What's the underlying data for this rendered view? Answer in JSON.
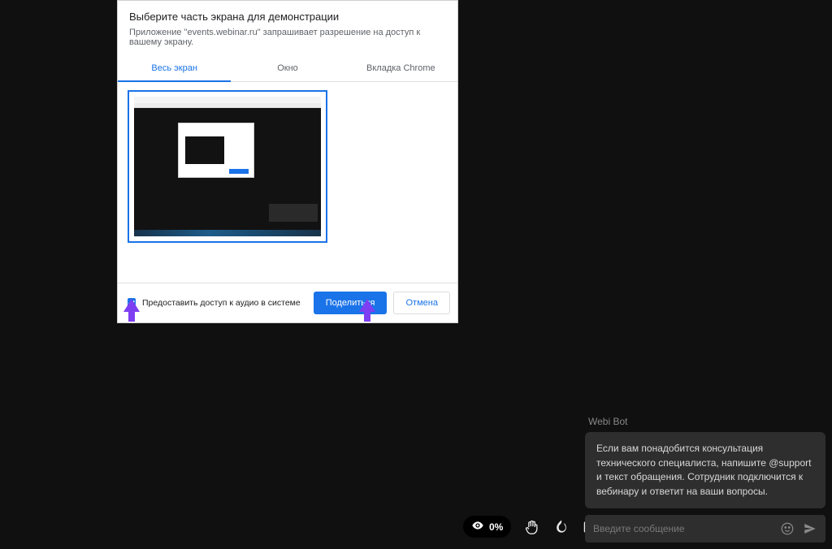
{
  "modal": {
    "title": "Выберите часть экрана для демонстрации",
    "subtitle": "Приложение \"events.webinar.ru\" запрашивает разрешение на доступ к вашему экрану.",
    "tabs": [
      {
        "label": "Весь экран",
        "active": true
      },
      {
        "label": "Окно",
        "active": false
      },
      {
        "label": "Вкладка Chrome",
        "active": false
      }
    ],
    "share_audio_label": "Предоставить доступ к аудио в системе",
    "share_button": "Поделиться",
    "cancel_button": "Отмена"
  },
  "chat": {
    "bot_name": "Webi Bot",
    "bot_message": "Если вам понадобится консультация технического специалиста, напишите @support и текст обращения. Сотрудник подключится к вебинару и ответит на ваши вопросы.",
    "input_placeholder": "Введите сообщение"
  },
  "toolbar": {
    "viewers": "0%"
  }
}
